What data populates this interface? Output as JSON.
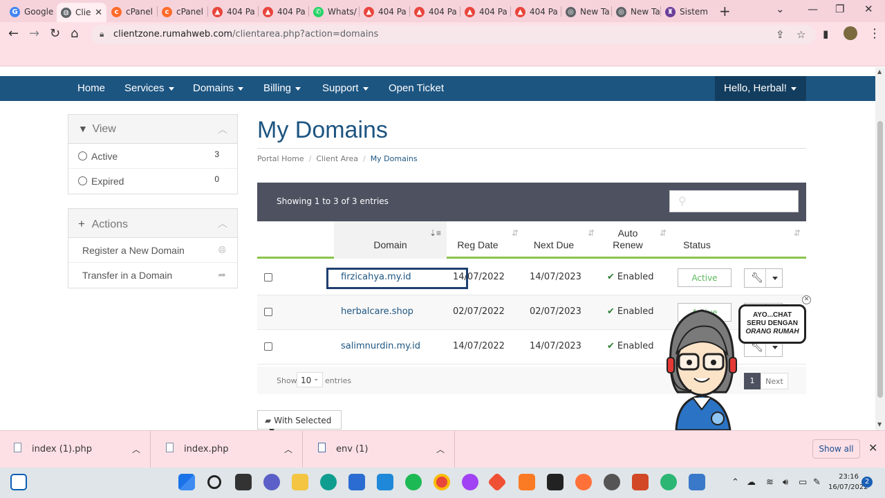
{
  "browser": {
    "tabs": [
      {
        "label": "Google",
        "icon": "google-icon",
        "color": "#4285f4"
      },
      {
        "label": "Clie",
        "icon": "globe-icon",
        "color": "#5f6368",
        "active": true
      },
      {
        "label": "cPanel",
        "icon": "cpanel-icon",
        "color": "#ff6c2c"
      },
      {
        "label": "cPanel",
        "icon": "cpanel-icon",
        "color": "#ff6c2c"
      },
      {
        "label": "404 Pa",
        "icon": "flame-icon",
        "color": "#e8453c"
      },
      {
        "label": "404 Pa",
        "icon": "flame-icon",
        "color": "#e8453c"
      },
      {
        "label": "Whats/",
        "icon": "whatsapp-icon",
        "color": "#25d366"
      },
      {
        "label": "404 Pa",
        "icon": "flame-icon",
        "color": "#e8453c"
      },
      {
        "label": "404 Pa",
        "icon": "flame-icon",
        "color": "#e8453c"
      },
      {
        "label": "404 Pa",
        "icon": "flame-icon",
        "color": "#e8453c"
      },
      {
        "label": "404 Pa",
        "icon": "flame-icon",
        "color": "#e8453c"
      },
      {
        "label": "New Ta",
        "icon": "chrome-icon",
        "color": "#5f6368"
      },
      {
        "label": "New Ta",
        "icon": "chrome-icon",
        "color": "#5f6368"
      },
      {
        "label": "Sistem",
        "icon": "app-icon",
        "color": "#6a3d9a"
      }
    ],
    "url_host": "clientzone.rumahweb.com",
    "url_path": "/clientarea.php?action=domains"
  },
  "nav": {
    "home": "Home",
    "services": "Services",
    "domains": "Domains",
    "billing": "Billing",
    "support": "Support",
    "open_ticket": "Open Ticket",
    "hello": "Hello, Herbal!"
  },
  "sidebar": {
    "view": {
      "title": "View",
      "items": [
        {
          "label": "Active",
          "count": "3"
        },
        {
          "label": "Expired",
          "count": "0"
        }
      ]
    },
    "actions": {
      "title": "Actions",
      "items": [
        {
          "label": "Register a New Domain",
          "icon": "globe-icon"
        },
        {
          "label": "Transfer in a Domain",
          "icon": "share-arrow-icon"
        }
      ]
    }
  },
  "main": {
    "title": "My Domains",
    "breadcrumb": [
      "Portal Home",
      "Client Area",
      "My Domains"
    ],
    "showing": "Showing 1 to 3 of 3 entries",
    "columns": {
      "domain": "Domain",
      "reg_date": "Reg Date",
      "next_due": "Next Due",
      "auto_renew_1": "Auto",
      "auto_renew_2": "Renew",
      "status": "Status"
    },
    "rows": [
      {
        "domain": "firzicahya.my.id",
        "reg": "14/07/2022",
        "due": "14/07/2023",
        "renew": "Enabled",
        "status": "Active"
      },
      {
        "domain": "herbalcare.shop",
        "reg": "02/07/2022",
        "due": "02/07/2023",
        "renew": "Enabled",
        "status": "Active"
      },
      {
        "domain": "salimnurdin.my.id",
        "reg": "14/07/2022",
        "due": "14/07/2023",
        "renew": "Enabled",
        "status": "Active"
      }
    ],
    "footer": {
      "show": "Show",
      "page_size": "10",
      "entries": "entries",
      "page": "1",
      "next": "Next"
    },
    "with_selected": "With Selected"
  },
  "chat": {
    "line1": "AYO...CHAT",
    "line2": "SERU DENGAN",
    "line3": "ORANG RUMAH"
  },
  "downloads": {
    "items": [
      "index (1).php",
      "index.php",
      "env (1)"
    ],
    "show_all": "Show all"
  },
  "taskbar": {
    "time": "23:16",
    "date": "16/07/2022",
    "notifications": "2"
  },
  "colors": {
    "nav_bg": "#1d5581",
    "accent_green": "#8bc34a",
    "status_green": "#5cb85c",
    "chrome_pink": "#fde0e6"
  }
}
